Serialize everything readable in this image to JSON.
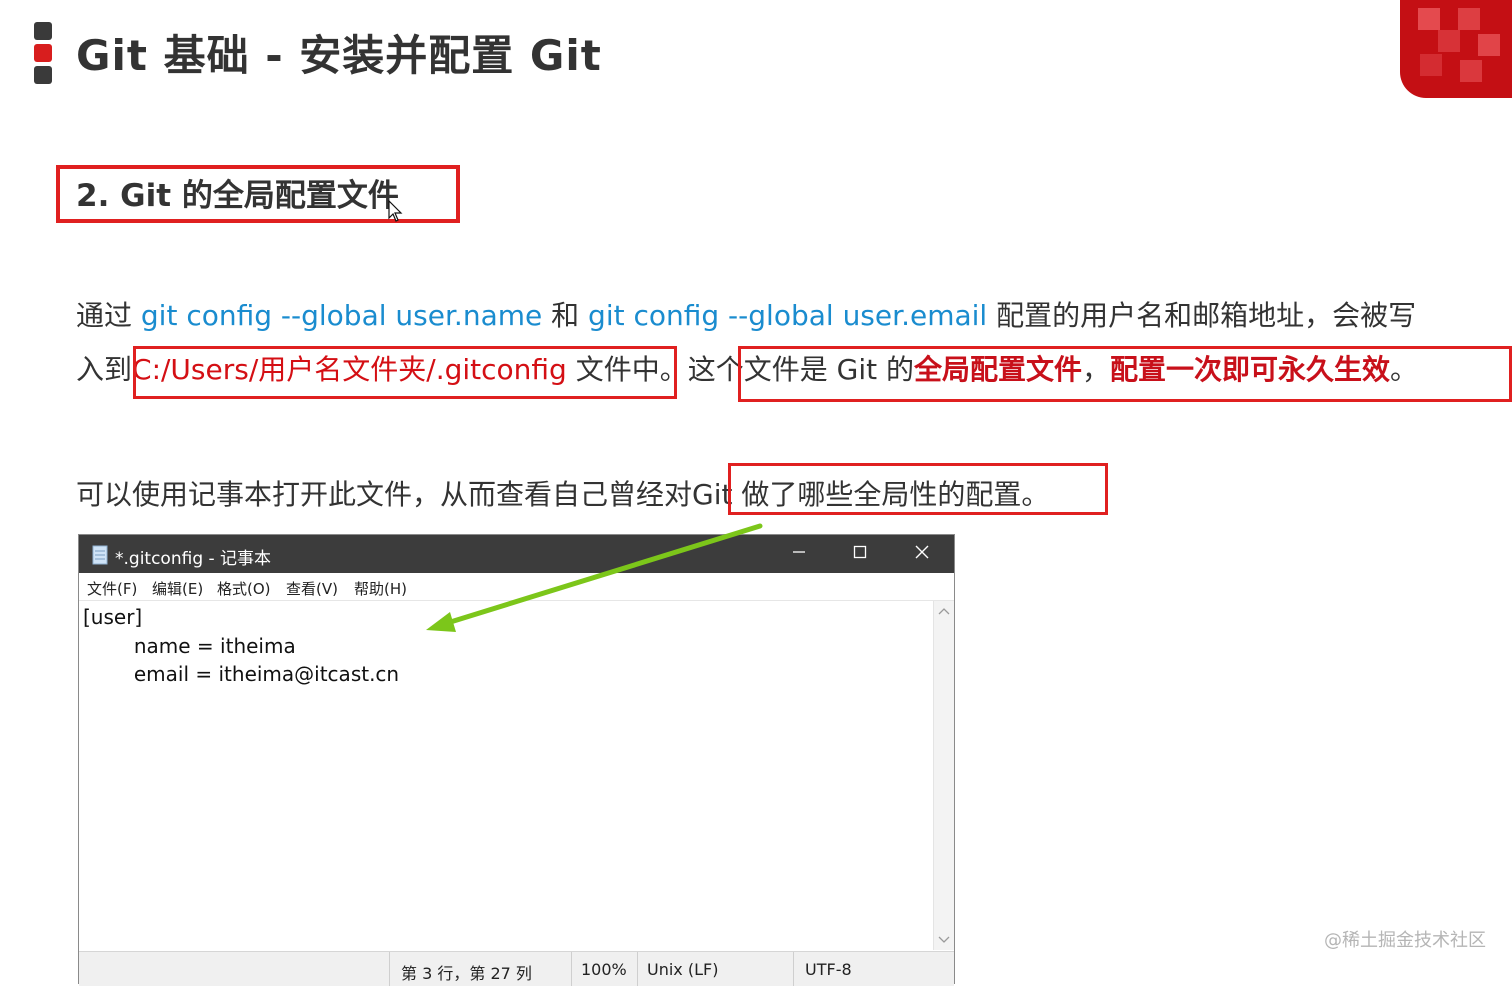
{
  "header": {
    "title": "Git 基础 - 安装并配置 Git"
  },
  "section": {
    "title": "2. Git 的全局配置文件"
  },
  "paragraph1": {
    "t1": "通过 ",
    "c1": "git config --global user.name",
    "t2": " 和 ",
    "c2": "git config --global user.email",
    "t3": " 配置的用户名和邮箱地址，会被写"
  },
  "paragraph2": {
    "t1": "入到",
    "path": "C:/Users/用户名文件夹/.gitconfig",
    "t2": " 文件中。",
    "t3": "这个文件是 Git 的",
    "s1": "全局配置文件",
    "t4": "，",
    "s2": "配置一次即可永久生效",
    "t5": "。"
  },
  "paragraph3": {
    "t1": "可以使用记事本打开此文件，从而查看自己曾经对",
    "t2": "Git 做了哪些全局性的配置。"
  },
  "notepad": {
    "title": "*.gitconfig - 记事本",
    "menu": [
      "文件(F)",
      "编辑(E)",
      "格式(O)",
      "查看(V)",
      "帮助(H)"
    ],
    "content": "[user]\n\t\tname = itheima\n\t\temail = itheima@itcast.cn",
    "status": {
      "position": "第 3 行，第 27 列",
      "zoom": "100%",
      "line_ending": "Unix (LF)",
      "encoding": "UTF-8"
    }
  },
  "watermark": "@稀土掘金技术社区",
  "colors": {
    "accent_red": "#d81e1e",
    "code_blue": "#1a8ccf",
    "arrow_green": "#7cc61a"
  },
  "icons": [
    "notepad-document-icon",
    "minimize-icon",
    "maximize-icon",
    "close-icon",
    "mouse-cursor-icon",
    "green-arrow-icon"
  ]
}
